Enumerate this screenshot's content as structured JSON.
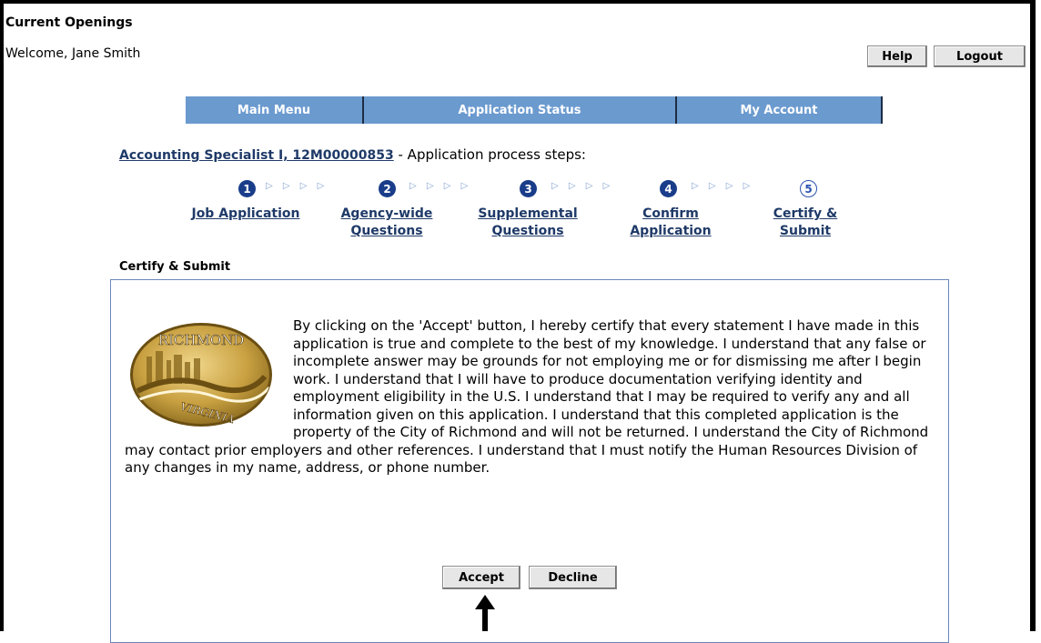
{
  "header": {
    "title": "Current Openings",
    "welcome": "Welcome, Jane Smith",
    "help_label": "Help",
    "logout_label": "Logout"
  },
  "nav": {
    "items": [
      {
        "label": "Main Menu"
      },
      {
        "label": "Application Status"
      },
      {
        "label": "My Account"
      }
    ]
  },
  "job": {
    "link_text": "Accounting Specialist I, 12M00000853",
    "suffix": " - Application process steps:"
  },
  "steps": [
    {
      "number": "1",
      "line1": "Job Application",
      "line2": ""
    },
    {
      "number": "2",
      "line1": "Agency-wide",
      "line2": "Questions"
    },
    {
      "number": "3",
      "line1": "Supplemental",
      "line2": "Questions"
    },
    {
      "number": "4",
      "line1": "Confirm",
      "line2": "Application"
    },
    {
      "number": "5",
      "line1": "Certify &",
      "line2": "Submit"
    }
  ],
  "step_arrows": "▷ ▷ ▷ ▷",
  "section": {
    "title": "Certify & Submit"
  },
  "seal": {
    "top_text": "RICHMOND",
    "bottom_text": "VIRGINIA"
  },
  "certification_text": "By clicking on the 'Accept' button, I hereby certify that every statement I have made in this application is true and complete to the best of my knowledge. I understand that any false or incomplete answer may be grounds for not employing me or for dismissing me after I begin work. I understand that I will have to produce documentation verifying identity and employment eligibility in the U.S. I understand that I may be required to verify any and all information given on this application. I understand that this completed application is the property of the City of Richmond and will not be returned. I understand the City of Richmond may contact prior employers and other references. I understand that I must notify the Human Resources Division of any changes in my name, address, or phone number.",
  "actions": {
    "accept_label": "Accept",
    "decline_label": "Decline"
  },
  "colors": {
    "nav_bar": "#6b9acf",
    "link": "#1f3a68",
    "step_fill": "#1a3d8a",
    "panel_border": "#6b87b8"
  }
}
